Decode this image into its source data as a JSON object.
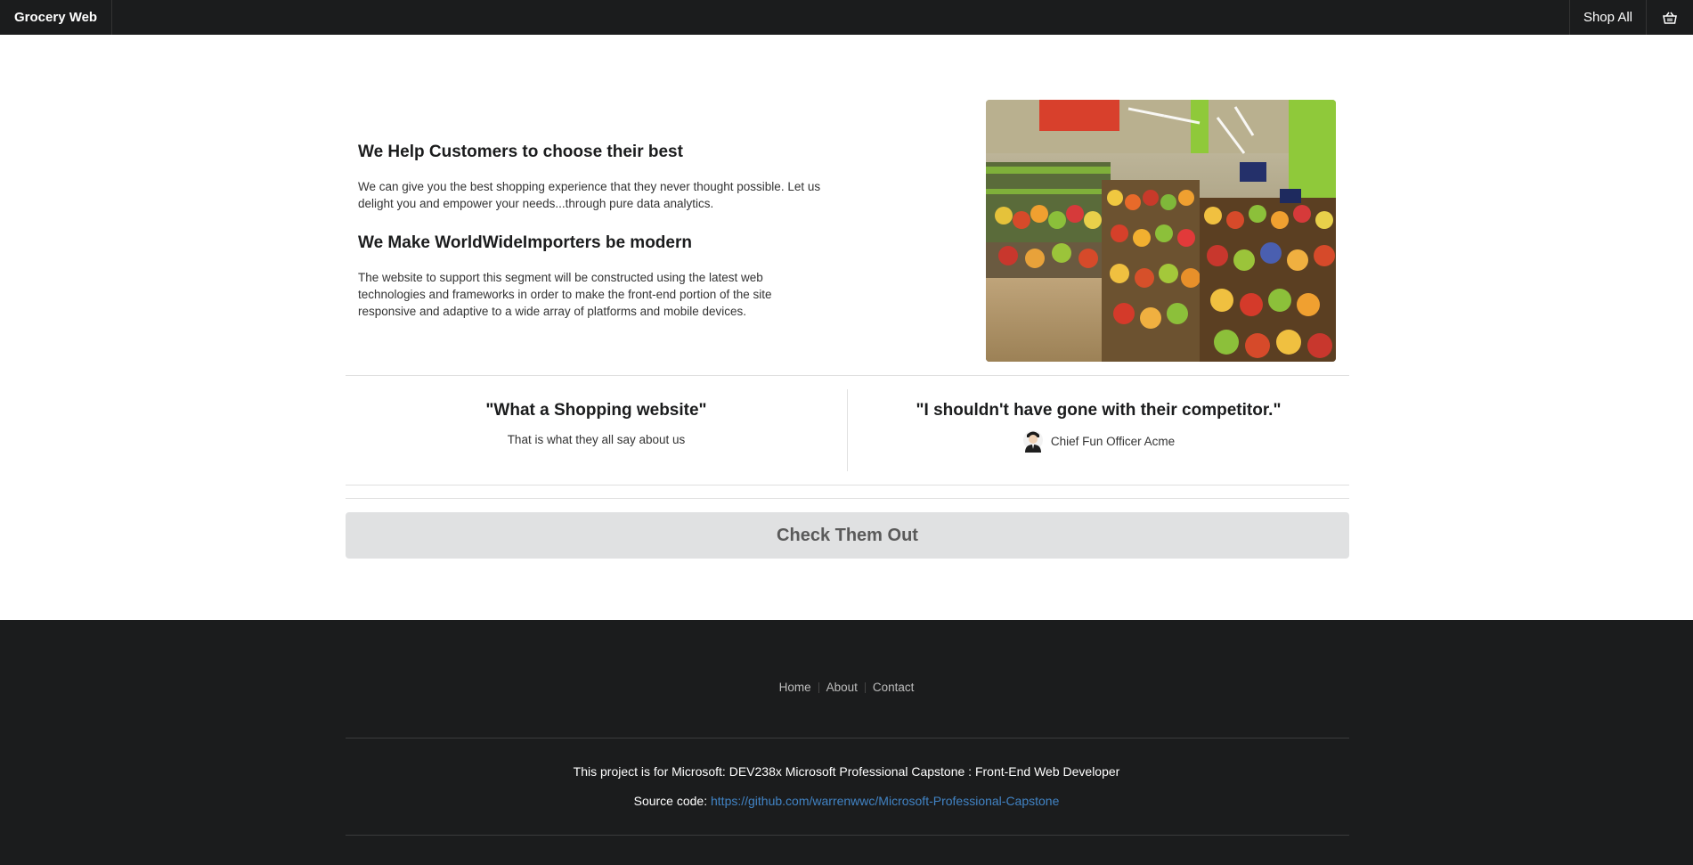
{
  "nav": {
    "brand": "Grocery Web",
    "shop_all": "Shop All",
    "cart_icon": "shopping-basket-icon"
  },
  "hero": {
    "heading1": "We Help Customers to choose their best",
    "para1": "We can give you the best shopping experience that they never thought possible. Let us delight you and empower your needs...through pure data analytics.",
    "heading2": "We Make WorldWideImporters be modern",
    "para2": "The website to support this segment will be constructed using the latest web technologies and frameworks in order to make the front-end portion of the site responsive and adaptive to a wide array of platforms and mobile devices."
  },
  "quotes": {
    "left_title": "\"What a Shopping website\"",
    "left_text": "That is what they all say about us",
    "right_title": "\"I shouldn't have gone with their competitor.\"",
    "right_author": "Chief Fun Officer Acme"
  },
  "cta": {
    "label": "Check Them Out"
  },
  "footer": {
    "links": [
      "Home",
      "About",
      "Contact"
    ],
    "project": "This project is for Microsoft: DEV238x Microsoft Professional Capstone : Front-End Web Developer",
    "source_label": "Source code:",
    "source_url": "https://github.com/warrenwwc/Microsoft-Professional-Capstone"
  },
  "colors": {
    "bar": "#1b1c1d",
    "button": "#e0e1e2",
    "link": "#4183c4"
  }
}
